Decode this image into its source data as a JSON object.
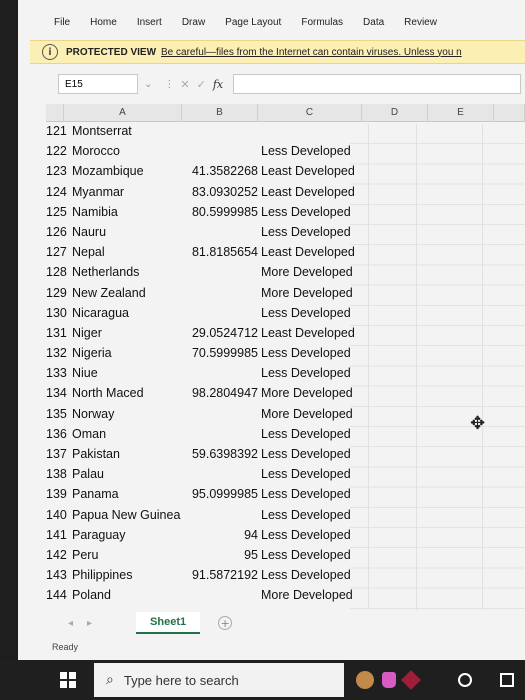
{
  "ribbon": {
    "tabs": [
      "File",
      "Home",
      "Insert",
      "Draw",
      "Page Layout",
      "Formulas",
      "Data",
      "Review"
    ]
  },
  "protected_view": {
    "label": "PROTECTED VIEW",
    "message": "Be careful—files from the Internet can contain viruses. Unless you n"
  },
  "formula_bar": {
    "name_box": "E15",
    "fx_label": "fx",
    "value": ""
  },
  "columns": [
    "A",
    "B",
    "C",
    "D",
    "E"
  ],
  "rows": [
    {
      "n": "121",
      "a": "Montserrat",
      "b": "",
      "c": ""
    },
    {
      "n": "122",
      "a": "Morocco",
      "b": "",
      "c": "Less Developed"
    },
    {
      "n": "123",
      "a": "Mozambique",
      "b": "41.3582268",
      "c": "Least Developed"
    },
    {
      "n": "124",
      "a": "Myanmar",
      "b": "83.0930252",
      "c": "Least Developed"
    },
    {
      "n": "125",
      "a": "Namibia",
      "b": "80.5999985",
      "c": "Less Developed"
    },
    {
      "n": "126",
      "a": "Nauru",
      "b": "",
      "c": "Less Developed"
    },
    {
      "n": "127",
      "a": "Nepal",
      "b": "81.8185654",
      "c": "Least Developed"
    },
    {
      "n": "128",
      "a": "Netherlands",
      "b": "",
      "c": "More Developed"
    },
    {
      "n": "129",
      "a": "New Zealand",
      "b": "",
      "c": "More Developed"
    },
    {
      "n": "130",
      "a": "Nicaragua",
      "b": "",
      "c": "Less Developed"
    },
    {
      "n": "131",
      "a": "Niger",
      "b": "29.0524712",
      "c": "Least Developed"
    },
    {
      "n": "132",
      "a": "Nigeria",
      "b": "70.5999985",
      "c": "Less Developed"
    },
    {
      "n": "133",
      "a": "Niue",
      "b": "",
      "c": "Less Developed"
    },
    {
      "n": "134",
      "a": "North Maced",
      "b": "98.2804947",
      "c": "More Developed"
    },
    {
      "n": "135",
      "a": "Norway",
      "b": "",
      "c": "More Developed"
    },
    {
      "n": "136",
      "a": "Oman",
      "b": "",
      "c": "Less Developed"
    },
    {
      "n": "137",
      "a": "Pakistan",
      "b": "59.6398392",
      "c": "Less Developed"
    },
    {
      "n": "138",
      "a": "Palau",
      "b": "",
      "c": "Less Developed"
    },
    {
      "n": "139",
      "a": "Panama",
      "b": "95.0999985",
      "c": "Less Developed"
    },
    {
      "n": "140",
      "a": "Papua New Guinea",
      "b": "",
      "c": "Less Developed"
    },
    {
      "n": "141",
      "a": "Paraguay",
      "b": "94",
      "c": "Less Developed"
    },
    {
      "n": "142",
      "a": "Peru",
      "b": "95",
      "c": "Less Developed"
    },
    {
      "n": "143",
      "a": "Philippines",
      "b": "91.5872192",
      "c": "Less Developed"
    },
    {
      "n": "144",
      "a": "Poland",
      "b": "",
      "c": "More Developed"
    }
  ],
  "sheet_tabs": [
    "Sheet1"
  ],
  "status": "Ready",
  "taskbar": {
    "search_placeholder": "Type here to search"
  },
  "colors": {
    "excel_green": "#217346",
    "protected_bar": "#fcefb4"
  }
}
